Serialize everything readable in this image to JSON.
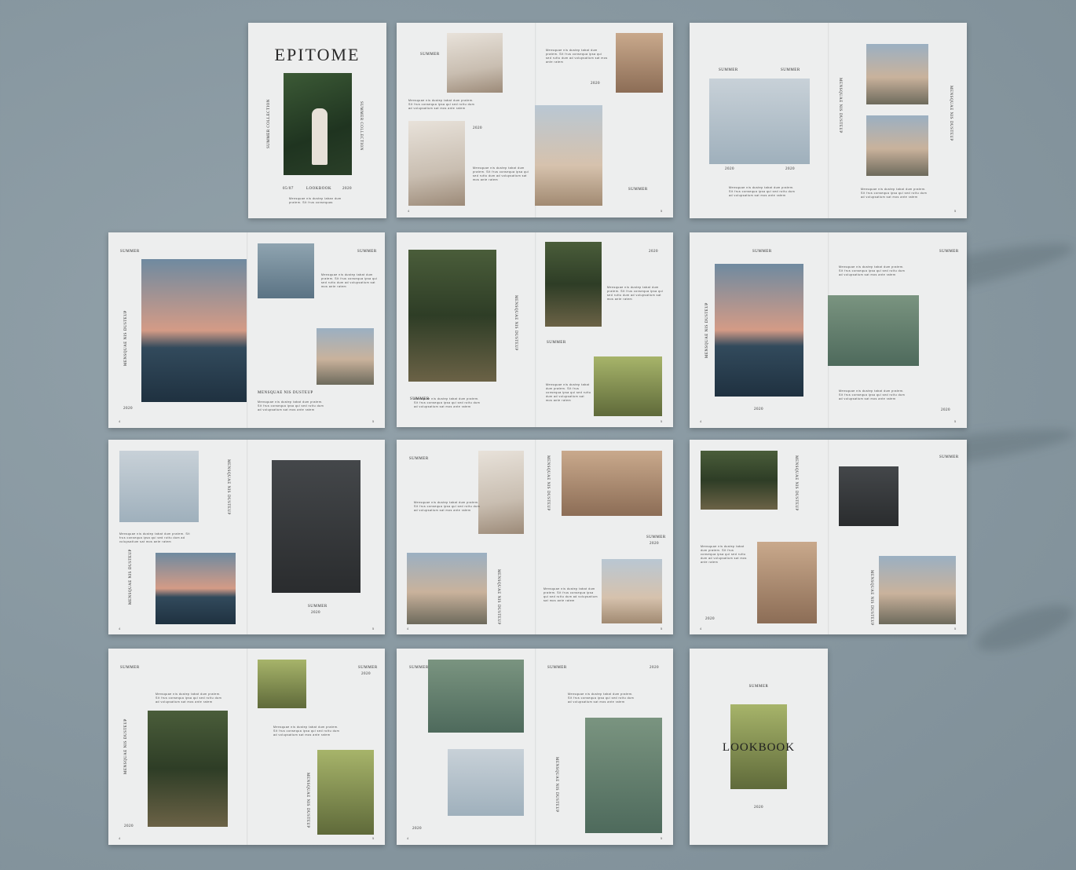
{
  "cover": {
    "title": "EPITOME",
    "left_vertical": "SUMMER COLLECTION",
    "right_vertical": "SUMMER COLLECTION",
    "date": "05/07",
    "label": "LOOKBOOK",
    "year": "2020",
    "blurb": "Mensquae nis dustep laban dum pratem. Sit frus consequas"
  },
  "labels": {
    "summer": "SUMMER",
    "year": "2020",
    "vertical_caption": "MENSQUAE NIS DUSTEUP",
    "body": "Mensquae nis dustep tabat dum pratem. Sit frus consequa ipsa qui sed ruttu dum ad volupsatium sat mos ante ratem",
    "page_left": "4",
    "page_right": "5"
  },
  "back_cover": {
    "summer": "SUMMER",
    "title": "LOOKBOOK",
    "year": "2020"
  }
}
